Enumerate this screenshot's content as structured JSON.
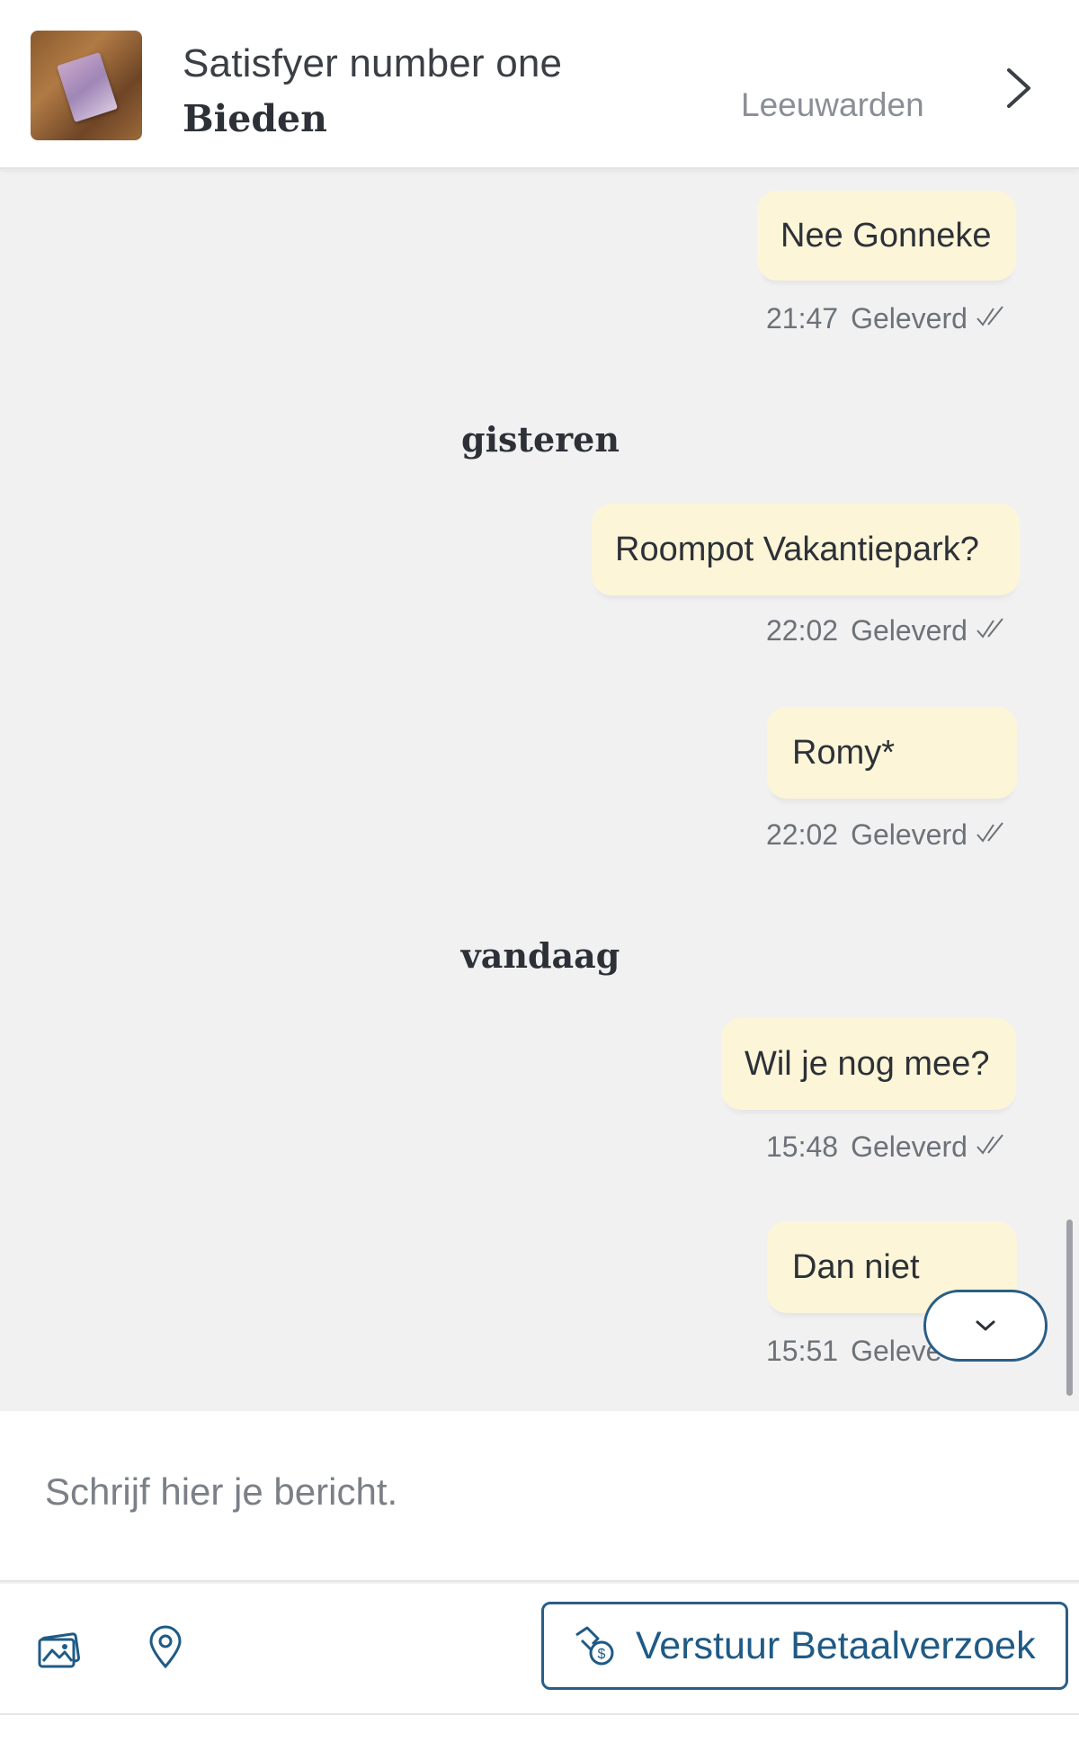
{
  "header": {
    "title": "Satisfyer number one",
    "subtitle": "Bieden",
    "location": "Leeuwarden"
  },
  "messages": [
    {
      "text": "Nee Gonneke",
      "time": "21:47",
      "status": "Geleverd"
    },
    {
      "text": "Roompot Vakantiepark?",
      "time": "22:02",
      "status": "Geleverd"
    },
    {
      "text": "Romy*",
      "time": "22:02",
      "status": "Geleverd"
    },
    {
      "text": "Wil je nog mee?",
      "time": "15:48",
      "status": "Geleverd"
    },
    {
      "text": "Dan niet",
      "time": "15:51",
      "status": "Geleve"
    }
  ],
  "day_separators": [
    "gisteren",
    "vandaag"
  ],
  "compose": {
    "placeholder": "Schrijf hier je bericht."
  },
  "toolbar": {
    "pay_label": "Verstuur Betaalverzoek"
  },
  "colors": {
    "bubble": "#fcf5d8",
    "accent": "#1f5a86",
    "background": "#f1f1f2"
  },
  "icons": [
    "product-thumbnail",
    "chevron-right-icon",
    "double-check-icon",
    "chevron-down-icon",
    "image-icon",
    "location-pin-icon",
    "payment-hand-icon"
  ]
}
